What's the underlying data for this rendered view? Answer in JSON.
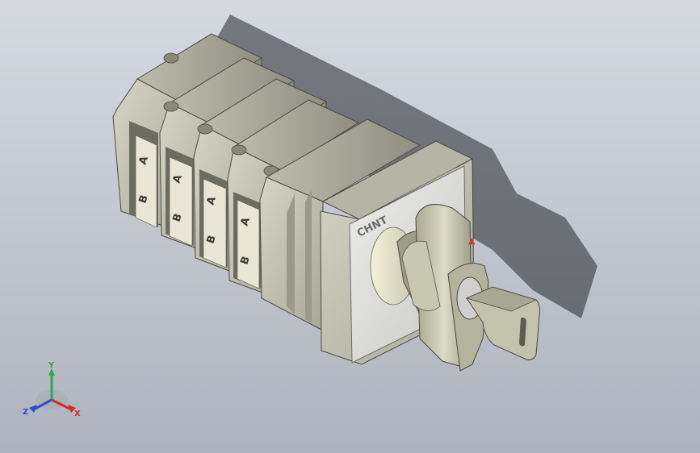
{
  "viewport": {
    "background_top": "#d6d9e0",
    "background_bottom": "#aeb3bd"
  },
  "model": {
    "brand_label": "CHNT",
    "module_labels": [
      {
        "top": "A",
        "bottom": "B"
      },
      {
        "top": "A",
        "bottom": "B"
      },
      {
        "top": "A",
        "bottom": "B"
      },
      {
        "top": "A",
        "bottom": "B"
      }
    ],
    "handle_marker": "▲",
    "colors": {
      "body": "#c9c8b8",
      "body_dark": "#7d7c70",
      "face": "#dcdcd8",
      "label_bg": "#eae6d6",
      "marker": "#d9392b"
    }
  },
  "triad": {
    "x_label": "X",
    "y_label": "Y",
    "z_label": "Z",
    "x_color": "#d22c2c",
    "y_color": "#2aa84a",
    "z_color": "#2a4fd2"
  }
}
